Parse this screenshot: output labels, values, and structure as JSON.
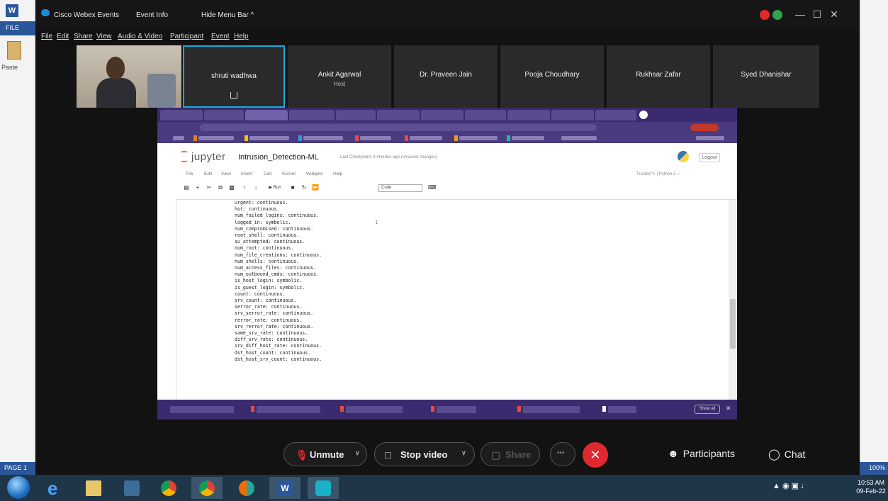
{
  "word": {
    "file_tab": "FILE",
    "paste_label": "Paste",
    "page_status": "PAGE 1",
    "zoom": "100%"
  },
  "webex": {
    "title_tabs": [
      "Cisco Webex Events",
      "Event Info",
      "Hide Menu Bar ^"
    ],
    "menu": [
      "File",
      "Edit",
      "Share",
      "View",
      "Audio & Video",
      "Participant",
      "Event",
      "Help"
    ],
    "window_controls": [
      "—",
      "☐",
      "✕"
    ],
    "participants": [
      {
        "name": "shruti wadhwa",
        "role": ""
      },
      {
        "name": "Ankit Agarwal",
        "role": "Host"
      },
      {
        "name": "Dr. Praveen Jain",
        "role": ""
      },
      {
        "name": "Pooja Choudhary",
        "role": ""
      },
      {
        "name": "Rukhsar Zafar",
        "role": ""
      },
      {
        "name": "Syed Dhanishar",
        "role": ""
      }
    ],
    "controls": {
      "unmute": "Unmute",
      "stop_video": "Stop video",
      "share": "Share",
      "more": "•••",
      "end": "✕",
      "participants": "Participants",
      "chat": "Chat"
    }
  },
  "jupyter": {
    "logo_text": "jupyter",
    "notebook_name": "Intrusion_Detection-ML",
    "checkpoint": "Last Checkpoint: 6 minutes ago  (unsaved changes)",
    "logout": "Logout",
    "menu": [
      "File",
      "Edit",
      "View",
      "Insert",
      "Cell",
      "Kernel",
      "Widgets",
      "Help"
    ],
    "trusted": "Trusted  ✎ | Python 3 ○",
    "cell_type": "Code",
    "run_label": "▶ Run",
    "cell_lines": [
      "urgent: continuous.",
      "hot: continuous.",
      "num_failed_logins: continuous.",
      "logged_in: symbolic.",
      "num_compromised: continuous.",
      "root_shell: continuous.",
      "su_attempted: continuous.",
      "num_root: continuous.",
      "num_file_creations: continuous.",
      "num_shells: continuous.",
      "num_access_files: continuous.",
      "num_outbound_cmds: continuous.",
      "is_host_login: symbolic.",
      "is_guest_login: symbolic.",
      "count: continuous.",
      "srv_count: continuous.",
      "serror_rate: continuous.",
      "srv_serror_rate: continuous.",
      "rerror_rate: continuous.",
      "srv_rerror_rate: continuous.",
      "same_srv_rate: continuous.",
      "diff_srv_rate: continuous.",
      "srv_diff_host_rate: continuous.",
      "dst_host_count: continuous.",
      "dst_host_srv_count: continuous."
    ],
    "show_all": "Show all"
  },
  "taskbar": {
    "time": "10:53 AM",
    "date": "09-Feb-22",
    "word_icon_text": "W"
  }
}
